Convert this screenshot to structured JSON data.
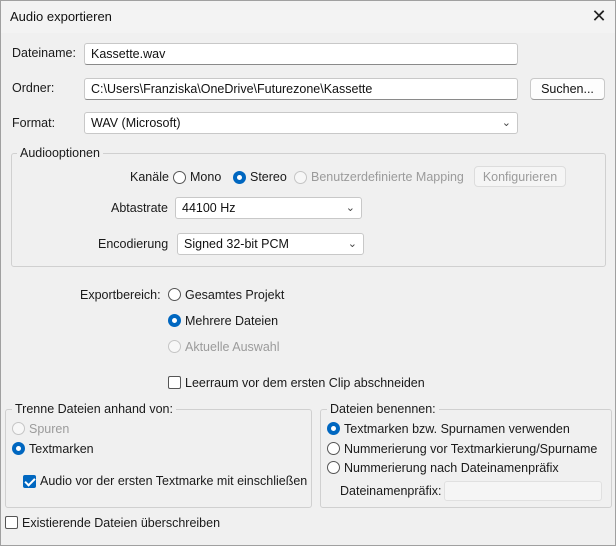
{
  "window": {
    "title": "Audio exportieren",
    "close_symbol": "✕"
  },
  "file": {
    "name_label": "Dateiname:",
    "name_value": "Kassette.wav",
    "folder_label": "Ordner:",
    "folder_value": "C:\\Users\\Franziska\\OneDrive\\Futurezone\\Kassette",
    "browse_label": "Suchen...",
    "format_label": "Format:",
    "format_value": "WAV (Microsoft)"
  },
  "audio_options": {
    "title": "Audiooptionen",
    "channels_label": "Kanäle",
    "channels": [
      {
        "label": "Mono",
        "checked": false,
        "enabled": true
      },
      {
        "label": "Stereo",
        "checked": true,
        "enabled": true
      },
      {
        "label": "Benutzerdefinierte Mapping",
        "checked": false,
        "enabled": false
      }
    ],
    "configure_label": "Konfigurieren",
    "sample_rate_label": "Abtastrate",
    "sample_rate_value": "44100 Hz",
    "encoding_label": "Encodierung",
    "encoding_value": "Signed 32-bit PCM"
  },
  "export_range": {
    "label": "Exportbereich:",
    "options": [
      {
        "label": "Gesamtes Projekt",
        "checked": false,
        "enabled": true
      },
      {
        "label": "Mehrere Dateien",
        "checked": true,
        "enabled": true
      },
      {
        "label": "Aktuelle Auswahl",
        "checked": false,
        "enabled": false
      }
    ],
    "trim_label": "Leerraum vor dem ersten Clip abschneiden",
    "trim_checked": false
  },
  "split": {
    "title": "Trenne Dateien anhand von:",
    "options": [
      {
        "label": "Spuren",
        "checked": false,
        "enabled": false
      },
      {
        "label": "Textmarken",
        "checked": true,
        "enabled": true
      }
    ],
    "include_label": "Audio vor der ersten Textmarke mit einschließen",
    "include_checked": true
  },
  "naming": {
    "title": "Dateien benennen:",
    "options": [
      {
        "label": "Textmarken bzw. Spurnamen verwenden",
        "checked": true
      },
      {
        "label": "Nummerierung vor Textmarkierung/Spurname",
        "checked": false
      },
      {
        "label": "Nummerierung nach Dateinamenpräfix",
        "checked": false
      }
    ],
    "prefix_label": "Dateinamenpräfix:",
    "prefix_value": ""
  },
  "overwrite": {
    "label": "Existierende Dateien überschreiben",
    "checked": false
  },
  "icons": {
    "close": "close-icon",
    "dropdown": "chevron-down-icon"
  }
}
